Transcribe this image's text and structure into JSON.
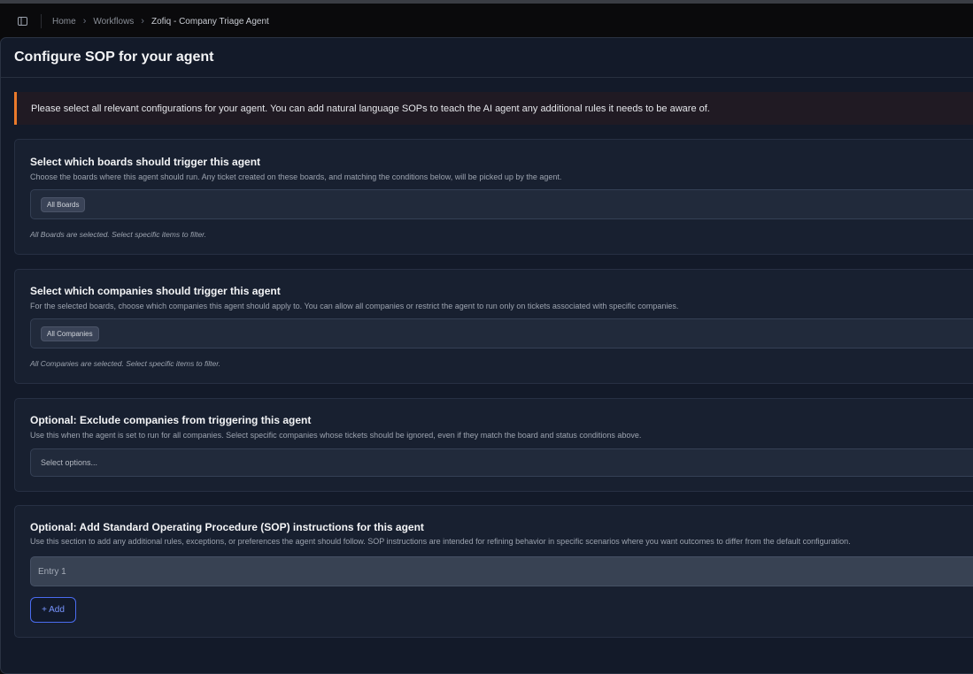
{
  "breadcrumb": [
    "Home",
    "Workflows",
    "Zofiq - Company Triage Agent"
  ],
  "page": {
    "title": "Configure SOP for your agent",
    "alert": "Please select all relevant configurations for your agent. You can add natural language SOPs to teach the AI agent any additional rules it needs to be aware of."
  },
  "boards": {
    "title": "Select which boards should trigger this agent",
    "description": "Choose the boards where this agent should run. Any ticket created on these boards, and matching the conditions below, will be picked up by the agent.",
    "selected_chip": "All Boards",
    "hint": "All Boards are selected. Select specific items to filter."
  },
  "companies": {
    "title": "Select which companies should trigger this agent",
    "description": "For the selected boards, choose which companies this agent should apply to. You can allow all companies or restrict the agent to run only on tickets associated with specific companies.",
    "selected_chip": "All Companies",
    "hint": "All Companies are selected. Select specific items to filter."
  },
  "exclude": {
    "title": "Optional: Exclude companies from triggering this agent",
    "description": "Use this when the agent is set to run for all companies. Select specific companies whose tickets should be ignored, even if they match the board and status conditions above.",
    "placeholder": "Select options..."
  },
  "sop": {
    "title": "Optional: Add Standard Operating Procedure (SOP) instructions for this agent",
    "description": "Use this section to add any additional rules, exceptions, or preferences the agent should follow. SOP instructions are intended for refining behavior in specific scenarios where you want outcomes to differ from the default configuration.",
    "entry_placeholder": "Entry 1",
    "add_label": "+ Add"
  },
  "colors": {
    "accent": "#4a6cf0",
    "alert_border": "#ea7a2b",
    "panel_bg": "#131a29",
    "card_bg": "#182030"
  },
  "icons": {
    "sidebar_toggle": "sidebar-panel-icon",
    "breadcrumb_separator": "chevron-right-icon"
  }
}
